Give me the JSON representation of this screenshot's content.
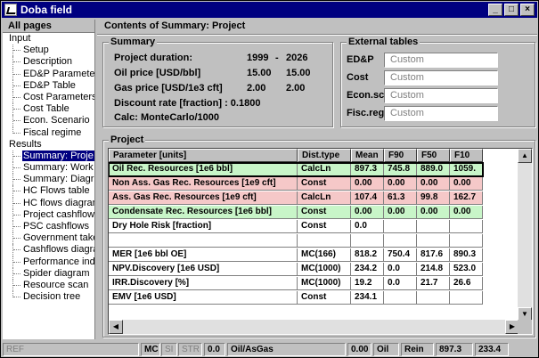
{
  "window": {
    "title": "Doba field"
  },
  "left": {
    "header": "All pages",
    "tree": [
      {
        "label": "Input",
        "level": 0
      },
      {
        "label": "Setup",
        "level": 1
      },
      {
        "label": "Description",
        "level": 1
      },
      {
        "label": "ED&P Paramete",
        "level": 1
      },
      {
        "label": "ED&P Table",
        "level": 1
      },
      {
        "label": "Cost Parameters",
        "level": 1
      },
      {
        "label": "Cost Table",
        "level": 1
      },
      {
        "label": "Econ. Scenario",
        "level": 1
      },
      {
        "label": "Fiscal regime",
        "level": 1,
        "last": true
      },
      {
        "label": "Results",
        "level": 0
      },
      {
        "label": "Summary: Proje",
        "level": 1,
        "selected": true
      },
      {
        "label": "Summary: Work",
        "level": 1
      },
      {
        "label": "Summary: Diagr",
        "level": 1
      },
      {
        "label": "HC Flows table",
        "level": 1
      },
      {
        "label": "HC flows diagran",
        "level": 1
      },
      {
        "label": "Project cashflow",
        "level": 1
      },
      {
        "label": "PSC cashflows",
        "level": 1
      },
      {
        "label": "Government take",
        "level": 1
      },
      {
        "label": "Cashflows diagra",
        "level": 1
      },
      {
        "label": "Performance ind.",
        "level": 1
      },
      {
        "label": "Spider diagram",
        "level": 1
      },
      {
        "label": "Resource scan",
        "level": 1
      },
      {
        "label": "Decision tree",
        "level": 1,
        "last": true
      }
    ]
  },
  "content": {
    "header": "Contents of Summary: Project",
    "summary": {
      "legend": "Summary",
      "duration_label": "Project duration:",
      "duration_start": "1999",
      "duration_dash": "-",
      "duration_end": "2026",
      "oil_label": "Oil price [USD/bbl]",
      "oil_v1": "15.00",
      "oil_v2": "15.00",
      "gas_label": "Gas price [USD/1e3 cft]",
      "gas_v1": "2.00",
      "gas_v2": "2.00",
      "discount": "Discount rate [fraction] : 0.1800",
      "calc": "Calc: MonteCarlo/1000"
    },
    "external": {
      "legend": "External tables",
      "rows": [
        {
          "label": "ED&P",
          "value": "Custom"
        },
        {
          "label": "Cost",
          "value": "Custom"
        },
        {
          "label": "Econ.sc.",
          "value": "Custom"
        },
        {
          "label": "Fisc.reg.",
          "value": "Custom"
        }
      ]
    },
    "project": {
      "legend": "Project",
      "columns": [
        "Parameter [units]",
        "Dist.type",
        "Mean",
        "F90",
        "F50",
        "F10"
      ],
      "rows": [
        {
          "cells": [
            "Oil Rec. Resources [1e6 bbl]",
            "CalcLn",
            "897.3",
            "745.8",
            "889.0",
            "1059."
          ],
          "color": "green",
          "selected": true
        },
        {
          "cells": [
            "Non Ass. Gas Rec. Resources [1e9 cft]",
            "Const",
            "0.00",
            "0.00",
            "0.00",
            "0.00"
          ],
          "color": "red"
        },
        {
          "cells": [
            "Ass. Gas Rec. Resources [1e9 cft]",
            "CalcLn",
            "107.4",
            "61.3",
            "99.8",
            "162.7"
          ],
          "color": "red"
        },
        {
          "cells": [
            "Condensate Rec. Resources [1e6 bbl]",
            "Const",
            "0.00",
            "0.00",
            "0.00",
            "0.00"
          ],
          "color": "green"
        },
        {
          "cells": [
            "Dry Hole Risk [fraction]",
            "Const",
            "0.0",
            "",
            "",
            ""
          ],
          "color": "none"
        },
        {
          "cells": [
            "",
            "",
            "",
            "",
            "",
            ""
          ],
          "color": "none"
        },
        {
          "cells": [
            "MER [1e6 bbl OE]",
            "MC(166)",
            "818.2",
            "750.4",
            "817.6",
            "890.3"
          ],
          "color": "none"
        },
        {
          "cells": [
            "NPV.Discovery [1e6 USD]",
            "MC(1000)",
            "234.2",
            "0.0",
            "214.8",
            "523.0"
          ],
          "color": "none"
        },
        {
          "cells": [
            "IRR.Discovery [%]",
            "MC(1000)",
            "19.2",
            "0.0",
            "21.7",
            "26.6"
          ],
          "color": "none"
        },
        {
          "cells": [
            "EMV [1e6 USD]",
            "Const",
            "234.1",
            "",
            "",
            ""
          ],
          "color": "none"
        }
      ]
    }
  },
  "status": [
    {
      "text": "REF",
      "dim": true
    },
    {
      "text": "MC",
      "dim": false
    },
    {
      "text": "SI",
      "dim": true
    },
    {
      "text": "STR",
      "dim": true
    },
    {
      "text": "0.0",
      "dim": false
    },
    {
      "text": "Oil/AsGas",
      "dim": false
    },
    {
      "text": "0.00",
      "dim": false
    },
    {
      "text": "Oil",
      "dim": false
    },
    {
      "text": "Rein",
      "dim": false
    },
    {
      "text": "897.3",
      "dim": false
    },
    {
      "text": "233.4",
      "dim": false
    }
  ]
}
